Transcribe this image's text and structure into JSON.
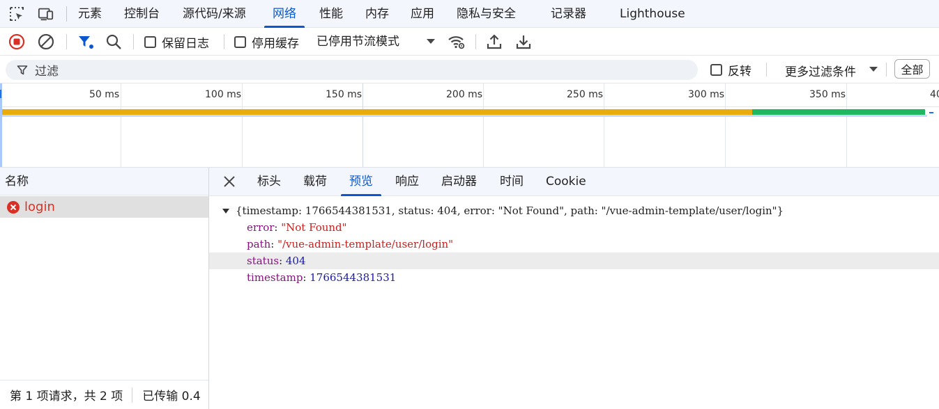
{
  "panel_tabs": [
    {
      "label": "元素"
    },
    {
      "label": "控制台"
    },
    {
      "label": "源代码/来源"
    },
    {
      "label": "网络",
      "active": true
    },
    {
      "label": "性能"
    },
    {
      "label": "内存"
    },
    {
      "label": "应用"
    },
    {
      "label": "隐私与安全"
    },
    {
      "label": "记录器"
    },
    {
      "label": "Lighthouse"
    }
  ],
  "toolbar": {
    "preserve_log_label": "保留日志",
    "disable_cache_label": "停用缓存",
    "throttling_value": "已停用节流模式"
  },
  "filter": {
    "placeholder": "过滤",
    "invert_label": "反转",
    "more_filters_label": "更多过滤条件",
    "all_label": "全部"
  },
  "timeline": {
    "tick_labels": [
      "50 ms",
      "100 ms",
      "150 ms",
      "200 ms",
      "250 ms",
      "300 ms",
      "350 ms",
      "40"
    ]
  },
  "requests": {
    "column_name": "名称",
    "rows": [
      {
        "name": "login",
        "status": "error"
      }
    ],
    "footer_count": "第 1 项请求，共 2 项",
    "footer_transferred": "已传输 0.4"
  },
  "details": {
    "tabs": [
      {
        "label": "标头"
      },
      {
        "label": "载荷"
      },
      {
        "label": "预览",
        "active": true
      },
      {
        "label": "响应"
      },
      {
        "label": "启动器"
      },
      {
        "label": "时间"
      },
      {
        "label": "Cookie"
      }
    ],
    "preview": {
      "summary": "{timestamp: 1766544381531, status: 404, error: \"Not Found\", path: \"/vue-admin-template/user/login\"}",
      "properties": [
        {
          "key": "error",
          "value": "\"Not Found\"",
          "type": "string"
        },
        {
          "key": "path",
          "value": "\"/vue-admin-template/user/login\"",
          "type": "string"
        },
        {
          "key": "status",
          "value": "404",
          "type": "number"
        },
        {
          "key": "timestamp",
          "value": "1766544381531",
          "type": "number"
        }
      ]
    }
  },
  "colors": {
    "accent": "#0b57d0",
    "error": "#d93025",
    "waiting_bar": "#e8ad0c",
    "download_bar": "#1fb75f"
  }
}
